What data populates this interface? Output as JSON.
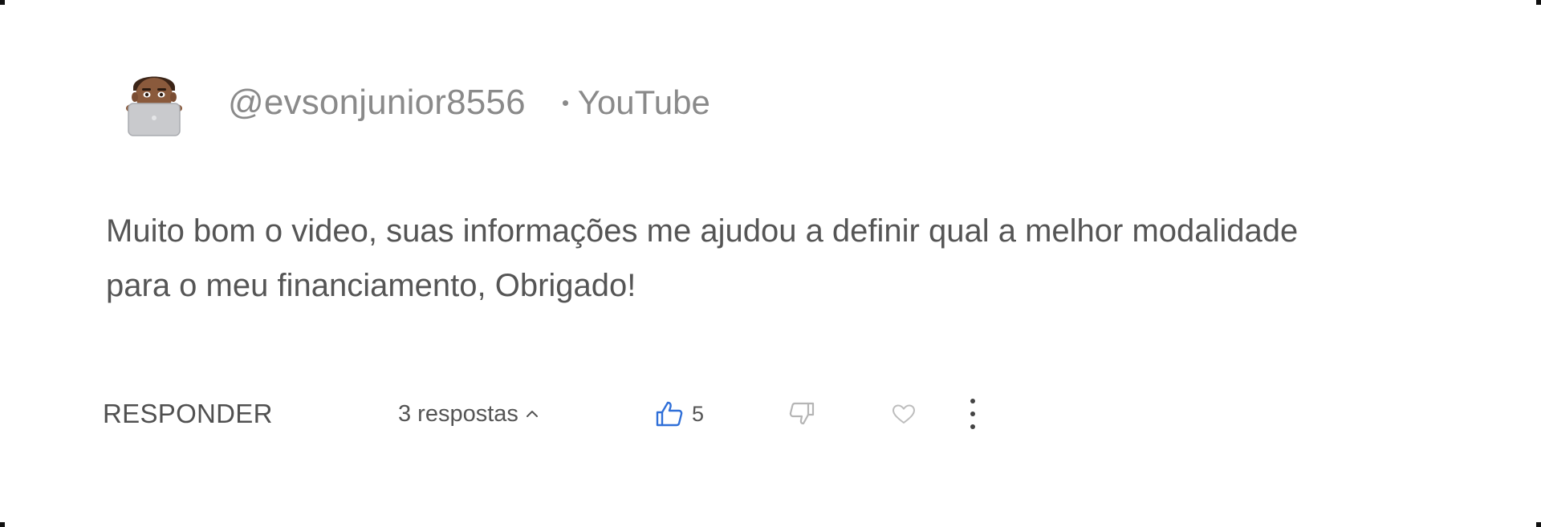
{
  "comment": {
    "author_handle": "@evsonjunior8556",
    "platform": "YouTube",
    "text": "Muito bom o video, suas informações me ajudou a definir qual a melhor modalidade para o meu financiamento, Obrigado!",
    "avatar_icon": "memoji-laptop-avatar-icon"
  },
  "actions": {
    "reply_label": "RESPONDER",
    "replies_label": "3 respostas",
    "like_count": "5",
    "like_icon": "thumbs-up-icon",
    "dislike_icon": "thumbs-down-icon",
    "heart_icon": "heart-icon",
    "more_icon": "more-vertical-icon"
  },
  "colors": {
    "accent_like": "#2f6fd8",
    "text": "#555555",
    "muted": "#8a8a8a"
  }
}
